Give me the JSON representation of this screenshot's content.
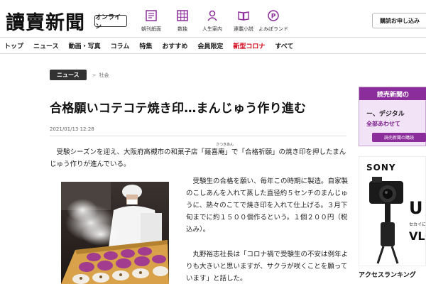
{
  "header": {
    "logo": "讀賣新聞",
    "badge": "オンライン",
    "nav": [
      {
        "label": "朝刊紙面",
        "icon": "newspaper-icon"
      },
      {
        "label": "数独",
        "icon": "grid-icon"
      },
      {
        "label": "人生案内",
        "icon": "person-icon"
      },
      {
        "label": "連載小説",
        "icon": "book-icon"
      },
      {
        "label": "よみぽランド",
        "icon": "points-icon"
      }
    ],
    "subscribe": "購読お申し込み"
  },
  "topnav": [
    "トップ",
    "ニュース",
    "動画・写真",
    "コラム",
    "特集",
    "おすすめ",
    "会員限定",
    "新型コロナ",
    "すべて"
  ],
  "article": {
    "tag": "ニュース",
    "category": "社会",
    "title": "合格願いコテコテ焼き印…まんじゅう作り進む",
    "timestamp": "2021/01/13 12:28",
    "ruby": "さつきあん",
    "lead": "受験シーズンを迎え、大阪府高槻市の和菓子店「薩喜庵」で「合格祈願」の焼き印を押したまんじゅう作りが進んでいる。",
    "body1": "受験生の合格を願い、毎年この時期に製造。自家製のこしあんを入れて蒸した直径約５センチのまんじゅうに、熱々のこてで焼き印を入れて仕上げる。３月下旬までに約１５００個作るという。１個２００円（税込み）。",
    "body2": "丸野裕志社長は「コロナ禍で受験生の不安は例年よりも大きいと思いますが、サクラが咲くことを願っています」と話した。"
  },
  "sidebar": {
    "promo_bar": "読売新聞の",
    "promo_line2": "ー、デジタル",
    "promo_line3": "全部あわせて",
    "promo_button": "読売新聞の購読",
    "ad_brand": "SONY",
    "ad_big": "U",
    "ad_tag1": "セカイに",
    "ad_tag2": "VLO",
    "ranking": "アクセスランキング"
  },
  "colors": {
    "accent": "#8b2d9a",
    "covid": "#d00014"
  }
}
